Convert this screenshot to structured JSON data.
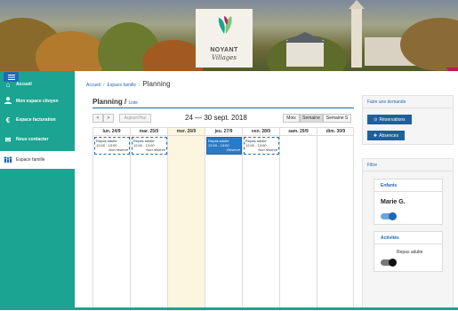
{
  "banner": {
    "logo_line1": "NOYANT",
    "logo_line2": "Villages"
  },
  "sidebar": {
    "items": [
      {
        "label": "Accueil",
        "icon": "home-icon"
      },
      {
        "label": "Mon espace citoyen",
        "icon": "user-icon"
      },
      {
        "label": "Espace facturation",
        "icon": "euro-icon"
      },
      {
        "label": "Nous contacter",
        "icon": "envelope-icon"
      },
      {
        "label": "Espace famille",
        "icon": "family-icon"
      }
    ]
  },
  "breadcrumb": {
    "home": "Accueil",
    "section": "Espace famille",
    "current": "Planning"
  },
  "planning": {
    "title": "Planning /",
    "view_link": "Liste",
    "prev": "<",
    "next": ">",
    "today": "Aujourd'hui",
    "date_range": "24 — 30 sept. 2018",
    "view_month": "Mois",
    "view_week": "Semaine",
    "view_week_short": "Semaine S"
  },
  "calendar": {
    "days": [
      "lun. 24/9",
      "mar. 25/9",
      "mer. 26/9",
      "jeu. 27/9",
      "ven. 28/9",
      "sam. 29/9",
      "dim. 30/9"
    ],
    "events": [
      {
        "title": "Repas adulte",
        "time": "12:00 - 13:00",
        "status": "Non réservé"
      },
      {
        "title": "Repas adulte",
        "time": "12:00 - 13:00",
        "status": "Non réservé"
      },
      {
        "title": "Repas adulte",
        "time": "12:00 - 13:00",
        "status": "Réservé"
      },
      {
        "title": "Repas adulte",
        "time": "12:00 - 13:00",
        "status": "Non réservé"
      }
    ]
  },
  "request_panel": {
    "title": "Faire une demande",
    "reservations": "Réservations",
    "absences": "Absences"
  },
  "filters": {
    "title": "Filtre",
    "children_title": "Enfants",
    "child_name": "Marie G.",
    "activities_title": "Activités",
    "activity_label": "Repas adulte"
  },
  "colors": {
    "teal": "#1aa491",
    "blue": "#1f68b4",
    "accent": "#c2185b"
  }
}
